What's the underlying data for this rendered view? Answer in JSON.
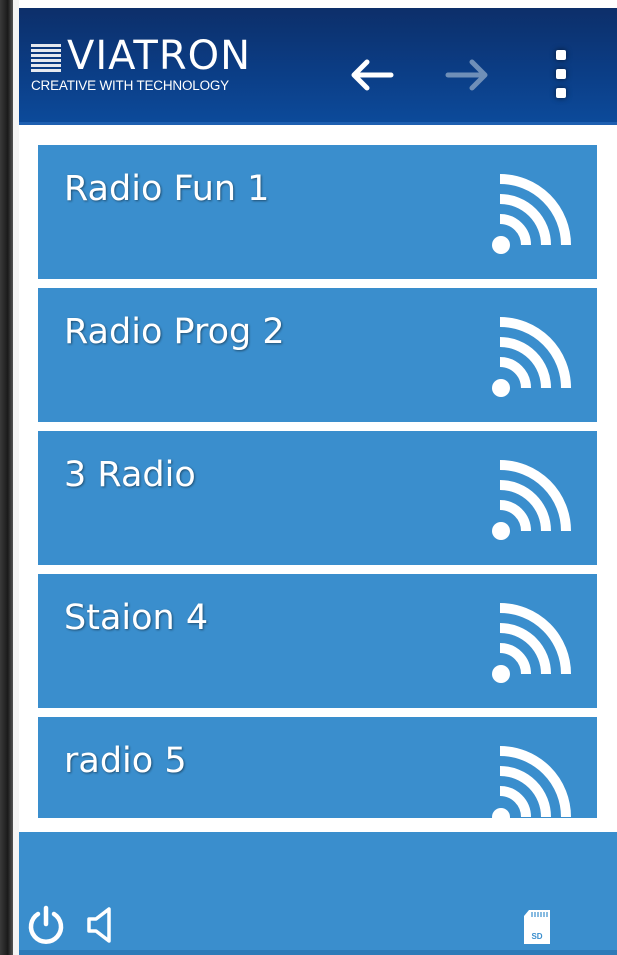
{
  "app": {
    "brand": {
      "name": "VIATRON",
      "tagline": "CREATIVE WITH TECHNOLOGY"
    },
    "header": {
      "back_icon": "arrow-left-icon",
      "forward_icon": "arrow-right-icon",
      "menu_icon": "vertical-dots-icon",
      "forward_enabled": false
    }
  },
  "stations": [
    {
      "label": "Radio Fun 1",
      "icon": "wifi-signal-icon"
    },
    {
      "label": "Radio Prog 2",
      "icon": "wifi-signal-icon"
    },
    {
      "label": "3 Radio",
      "icon": "wifi-signal-icon"
    },
    {
      "label": "Staion 4",
      "icon": "wifi-signal-icon"
    },
    {
      "label": "radio 5",
      "icon": "wifi-signal-icon"
    }
  ],
  "footer": {
    "power_icon": "power-icon",
    "volume_icon": "speaker-icon",
    "storage_icon": "sd-card-icon",
    "sd_label": "SD"
  },
  "colors": {
    "header_dark": "#0b3d85",
    "tile_blue": "#3a8ecd",
    "text": "#ffffff"
  }
}
